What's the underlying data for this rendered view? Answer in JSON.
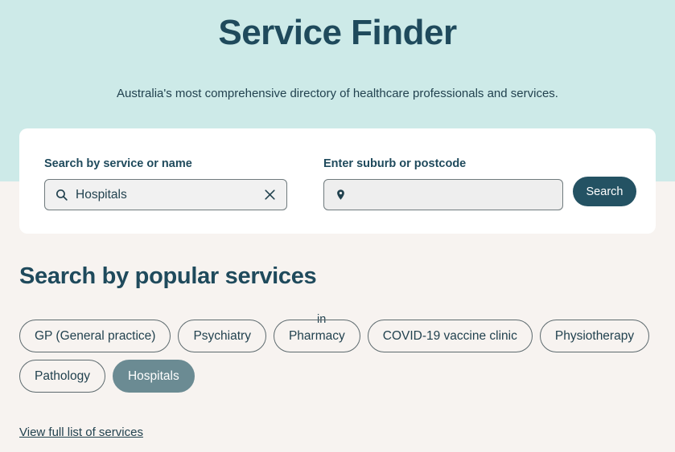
{
  "hero": {
    "title": "Service Finder",
    "subtitle": "Australia's most comprehensive directory of healthcare professionals and services."
  },
  "search_card": {
    "service_field": {
      "label": "Search by service or name",
      "value": "Hospitals",
      "placeholder": "",
      "search_icon": "search-icon",
      "clear_icon": "close-icon"
    },
    "separator": "in",
    "location_field": {
      "label": "Enter suburb or postcode",
      "value": "",
      "placeholder": "",
      "pin_icon": "map-pin-icon"
    },
    "search_button": "Search"
  },
  "popular": {
    "heading": "Search by popular services",
    "chips": [
      {
        "label": "GP (General practice)",
        "selected": false
      },
      {
        "label": "Psychiatry",
        "selected": false
      },
      {
        "label": "Pharmacy",
        "selected": false
      },
      {
        "label": "COVID-19 vaccine clinic",
        "selected": false
      },
      {
        "label": "Physiotherapy",
        "selected": false
      },
      {
        "label": "Pathology",
        "selected": false
      },
      {
        "label": "Hospitals",
        "selected": true
      }
    ],
    "full_list_link": "View full list of services"
  },
  "colors": {
    "hero_background": "#cdeae8",
    "page_background": "#f7f3f0",
    "brand_dark": "#1f4a5c",
    "button_background": "#245263",
    "chip_selected_background": "#6b8b93",
    "card_background": "#ffffff"
  }
}
